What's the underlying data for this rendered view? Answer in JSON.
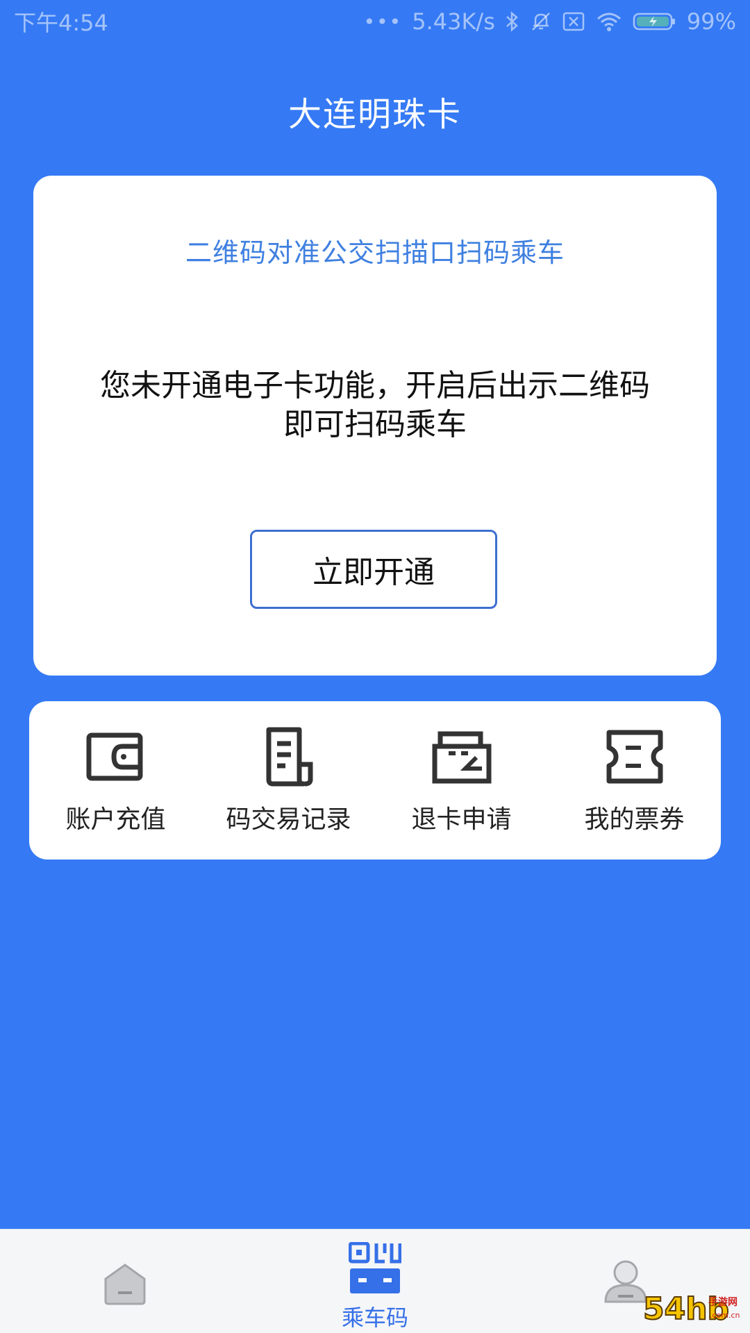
{
  "status_bar": {
    "time": "下午4:54",
    "network_speed": "5.43K/s",
    "battery": "99%"
  },
  "app": {
    "title": "大连明珠卡"
  },
  "main_card": {
    "scan_hint": "二维码对准公交扫描口扫码乘车",
    "notice": "您未开通电子卡功能，开启后出示二维码即可扫码乘车",
    "open_button": "立即开通"
  },
  "functions": [
    {
      "label": "账户充值",
      "icon": "wallet-icon"
    },
    {
      "label": "码交易记录",
      "icon": "receipt-icon"
    },
    {
      "label": "退卡申请",
      "icon": "card-return-icon"
    },
    {
      "label": "我的票券",
      "icon": "ticket-icon"
    }
  ],
  "bottom_nav": {
    "home_icon": "home-icon",
    "ride_code_label": "乘车码",
    "profile_icon": "profile-icon"
  },
  "watermark": "54hb手游网",
  "colors": {
    "background": "#357af4",
    "accent": "#3f80e0",
    "nav_active": "#3670e8"
  }
}
